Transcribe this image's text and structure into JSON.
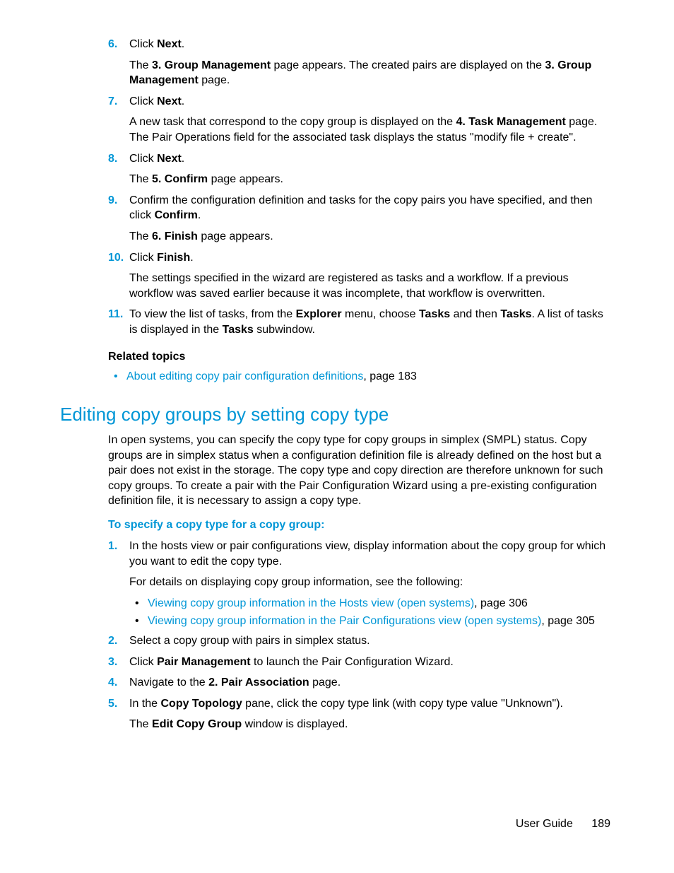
{
  "listA": [
    {
      "num": "6.",
      "main": [
        [
          "Click ",
          true,
          "Next"
        ],
        [
          "."
        ]
      ],
      "sub": [
        [
          [
            "The ",
            true,
            "3. Group Management"
          ],
          [
            " page appears. The created pairs are displayed on the ",
            true,
            "3. Group Management"
          ],
          [
            " page."
          ]
        ]
      ]
    },
    {
      "num": "7.",
      "main": [
        [
          "Click ",
          true,
          "Next"
        ],
        [
          "."
        ]
      ],
      "sub": [
        [
          [
            "A new task that correspond to the copy group is displayed on the ",
            true,
            "4. Task Management"
          ],
          [
            " page. The Pair Operations field for the associated task displays the status \"modify file + create\"."
          ]
        ]
      ]
    },
    {
      "num": "8.",
      "main": [
        [
          "Click ",
          true,
          "Next"
        ],
        [
          "."
        ]
      ],
      "sub": [
        [
          [
            "The ",
            true,
            "5. Confirm"
          ],
          [
            " page appears."
          ]
        ]
      ]
    },
    {
      "num": "9.",
      "main": [
        [
          "Confirm the configuration definition and tasks for the copy pairs you have specified, and then click ",
          true,
          "Confirm"
        ],
        [
          "."
        ]
      ],
      "sub": [
        [
          [
            "The ",
            true,
            "6. Finish"
          ],
          [
            " page appears."
          ]
        ]
      ]
    },
    {
      "num": "10.",
      "main": [
        [
          "Click ",
          true,
          "Finish"
        ],
        [
          "."
        ]
      ],
      "sub": [
        [
          [
            "The settings specified in the wizard are registered as tasks and a workflow. If a previous workflow was saved earlier because it was incomplete, that workflow is overwritten."
          ]
        ]
      ]
    },
    {
      "num": "11.",
      "main": [
        [
          "To view the list of tasks, from the ",
          true,
          "Explorer"
        ],
        [
          " menu, choose ",
          true,
          "Tasks"
        ],
        [
          " and then ",
          true,
          "Tasks"
        ],
        [
          ". A list of tasks is displayed in the ",
          true,
          "Tasks"
        ],
        [
          " subwindow."
        ]
      ]
    }
  ],
  "relatedHeading": "Related topics",
  "relatedLinks": [
    {
      "text": "About editing copy pair configuration definitions",
      "suffix": ", page 183"
    }
  ],
  "h2": "Editing copy groups by setting copy type",
  "intro": "In open systems, you can specify the copy type for copy groups in simplex (SMPL) status. Copy groups are in simplex status when a configuration definition file is already defined on the host but a pair does not exist in the storage.  The copy type and copy direction are therefore unknown for such copy groups. To create a pair with the Pair Configuration Wizard using a pre-existing configuration definition file, it is necessary to assign a copy type.",
  "subHeading": "To specify a copy type for a copy group:",
  "listB": [
    {
      "num": "1.",
      "main": [
        [
          "In the hosts view or pair configurations view, display information about the copy group for which you want to edit the copy type."
        ]
      ],
      "sub": [
        [
          [
            "For details on displaying copy group information, see the following:"
          ]
        ]
      ],
      "links": [
        {
          "text": "Viewing copy group information in the Hosts view (open systems)",
          "suffix": ", page 306"
        },
        {
          "text": "Viewing copy group information in the Pair Configurations view (open systems)",
          "suffix": ", page 305"
        }
      ]
    },
    {
      "num": "2.",
      "main": [
        [
          "Select a copy group with pairs in simplex status."
        ]
      ]
    },
    {
      "num": "3.",
      "main": [
        [
          "Click ",
          true,
          "Pair Management"
        ],
        [
          " to launch the Pair Configuration Wizard."
        ]
      ]
    },
    {
      "num": "4.",
      "main": [
        [
          "Navigate to the ",
          true,
          "2. Pair Association"
        ],
        [
          " page."
        ]
      ]
    },
    {
      "num": "5.",
      "main": [
        [
          "In the ",
          true,
          "Copy Topology"
        ],
        [
          " pane, click the copy type link (with copy type value \"Unknown\")."
        ]
      ],
      "sub": [
        [
          [
            "The ",
            true,
            "Edit Copy Group"
          ],
          [
            " window is displayed."
          ]
        ]
      ]
    }
  ],
  "footer": {
    "label": "User Guide",
    "page": "189"
  }
}
